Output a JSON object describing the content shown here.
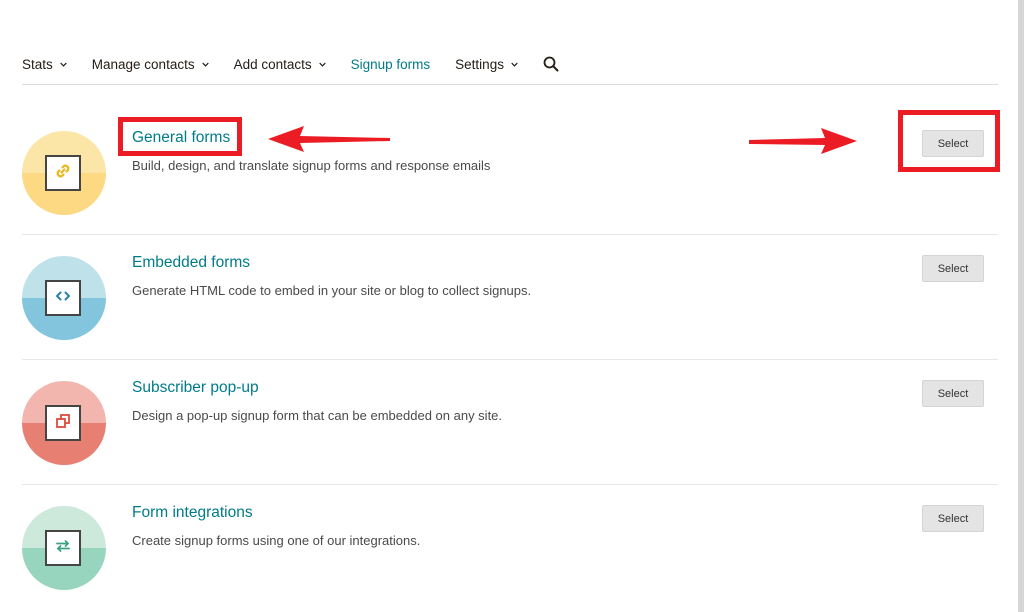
{
  "nav": {
    "items": [
      {
        "label": "Stats",
        "has_dropdown": true,
        "active": false
      },
      {
        "label": "Manage contacts",
        "has_dropdown": true,
        "active": false
      },
      {
        "label": "Add contacts",
        "has_dropdown": true,
        "active": false
      },
      {
        "label": "Signup forms",
        "has_dropdown": false,
        "active": true
      },
      {
        "label": "Settings",
        "has_dropdown": true,
        "active": false
      }
    ],
    "search_icon": "search-icon"
  },
  "forms": [
    {
      "title": "General forms",
      "description": "Build, design, and translate signup forms and response emails",
      "button": "Select",
      "icon": "link-icon",
      "colors": {
        "top": "#fbe6a8",
        "bottom": "#fdd983",
        "glyph": "#e8b71a"
      }
    },
    {
      "title": "Embedded forms",
      "description": "Generate HTML code to embed in your site or blog to collect signups.",
      "button": "Select",
      "icon": "code-icon",
      "colors": {
        "top": "#bfe1ea",
        "bottom": "#82c5dc",
        "glyph": "#2c7fb1"
      }
    },
    {
      "title": "Subscriber pop-up",
      "description": "Design a pop-up signup form that can be embedded on any site.",
      "button": "Select",
      "icon": "popup-icon",
      "colors": {
        "top": "#f2b6ae",
        "bottom": "#e77f72",
        "glyph": "#de4a3c"
      }
    },
    {
      "title": "Form integrations",
      "description": "Create signup forms using one of our integrations.",
      "button": "Select",
      "icon": "swap-arrows-icon",
      "colors": {
        "top": "#cce9dc",
        "bottom": "#98d5be",
        "glyph": "#3ca37f"
      }
    }
  ],
  "annotations": {
    "highlight_color": "#ec1c24"
  }
}
